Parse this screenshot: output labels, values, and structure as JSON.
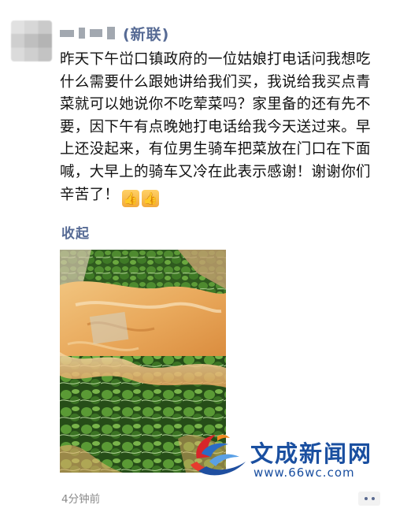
{
  "post": {
    "author": "(新联)",
    "content": "昨天下午峃口镇政府的一位姑娘打电话问我想吃什么需要什么跟她讲给我们买，我说给我买点青菜就可以她说你不吃荤菜吗？家里备的还有先不要，因下午有点晚她打电话给我今天送过来。早上还没起来，有位男生骑车把菜放在门口在下面喊，大早上的骑车又冷在此表示感谢！谢谢你们辛苦了！",
    "emojis": [
      "thumbs-up",
      "thumbs-up"
    ],
    "collapse_label": "收起",
    "timestamp": "4分钟前"
  },
  "watermark": {
    "name": "文成新闻网",
    "url": "www.66wc.com"
  },
  "colors": {
    "link": "#576b95",
    "text": "#111111",
    "time": "#8a8a8a",
    "watermark": "#1a4fa0"
  }
}
